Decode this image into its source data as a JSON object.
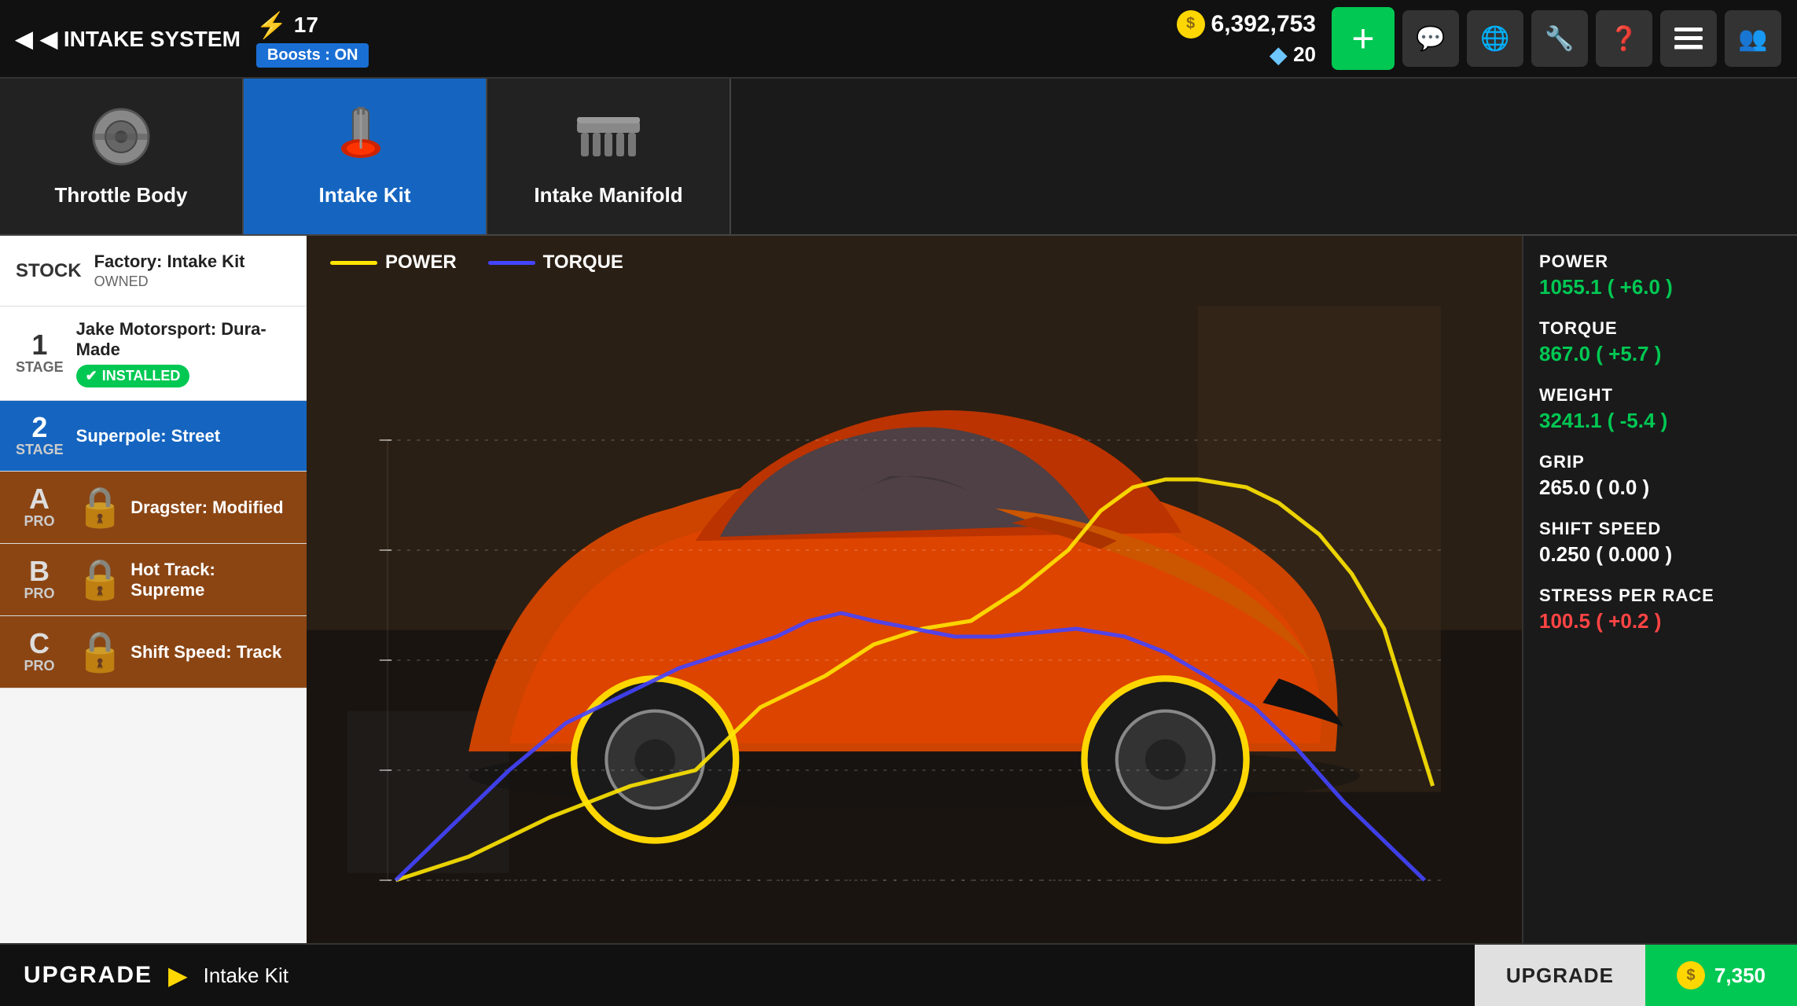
{
  "header": {
    "back_label": "◀  INTAKE SYSTEM",
    "lightning_label": "17",
    "boosts_label": "Boosts : ON",
    "gold_amount": "6,392,753",
    "diamond_amount": "20",
    "add_label": "+"
  },
  "top_icons": [
    {
      "name": "chat-icon",
      "symbol": "💬"
    },
    {
      "name": "globe-icon",
      "symbol": "🌐"
    },
    {
      "name": "wrench-icon",
      "symbol": "🔧"
    },
    {
      "name": "help-icon",
      "symbol": "❓"
    },
    {
      "name": "menu-icon",
      "symbol": "≡"
    },
    {
      "name": "people-icon",
      "symbol": "👥"
    }
  ],
  "part_tabs": [
    {
      "label": "Throttle Body",
      "active": false,
      "icon": "⚙"
    },
    {
      "label": "Intake Kit",
      "active": true,
      "icon": "🔴"
    },
    {
      "label": "Intake Manifold",
      "active": false,
      "icon": "🔩"
    }
  ],
  "upgrades": [
    {
      "stage": "STOCK",
      "stage_num": "",
      "name": "Factory: Intake Kit",
      "sub": "OWNED",
      "installed": false,
      "selected": false,
      "locked": false,
      "is_stock": true
    },
    {
      "stage": "STAGE",
      "stage_num": "1",
      "name": "Jake Motorsport: Dura-Made",
      "sub": "",
      "installed": true,
      "selected": false,
      "locked": false,
      "is_stock": false
    },
    {
      "stage": "STAGE",
      "stage_num": "2",
      "name": "Superpole: Street",
      "sub": "",
      "installed": false,
      "selected": true,
      "locked": false,
      "is_stock": false
    },
    {
      "stage": "PRO",
      "stage_num": "A",
      "name": "Dragster: Modified",
      "sub": "",
      "installed": false,
      "selected": false,
      "locked": true,
      "is_stock": false
    },
    {
      "stage": "PRO",
      "stage_num": "B",
      "name": "Hot Track: Supreme",
      "sub": "",
      "installed": false,
      "selected": false,
      "locked": true,
      "is_stock": false
    },
    {
      "stage": "PRO",
      "stage_num": "C",
      "name": "Shift Speed: Track",
      "sub": "",
      "installed": false,
      "selected": false,
      "locked": true,
      "is_stock": false
    }
  ],
  "chart": {
    "legend": [
      {
        "label": "POWER",
        "color": "#FFE600"
      },
      {
        "label": "TORQUE",
        "color": "#4444FF"
      }
    ]
  },
  "stats": [
    {
      "label": "POWER",
      "value": "1055.1 ( +6.0 )",
      "color": "green"
    },
    {
      "label": "TORQUE",
      "value": "867.0 ( +5.7 )",
      "color": "green"
    },
    {
      "label": "WEIGHT",
      "value": "3241.1 ( -5.4 )",
      "color": "green"
    },
    {
      "label": "GRIP",
      "value": "265.0 ( 0.0 )",
      "color": "white"
    },
    {
      "label": "SHIFT SPEED",
      "value": "0.250 ( 0.000 )",
      "color": "white"
    },
    {
      "label": "STRESS PER RACE",
      "value": "100.5 ( +0.2 )",
      "color": "red"
    }
  ],
  "bottom_bar": {
    "upgrade_label": "UPGRADE",
    "part_name": "Intake Kit",
    "upgrade_btn": "UPGRADE",
    "cost": "7,350"
  }
}
